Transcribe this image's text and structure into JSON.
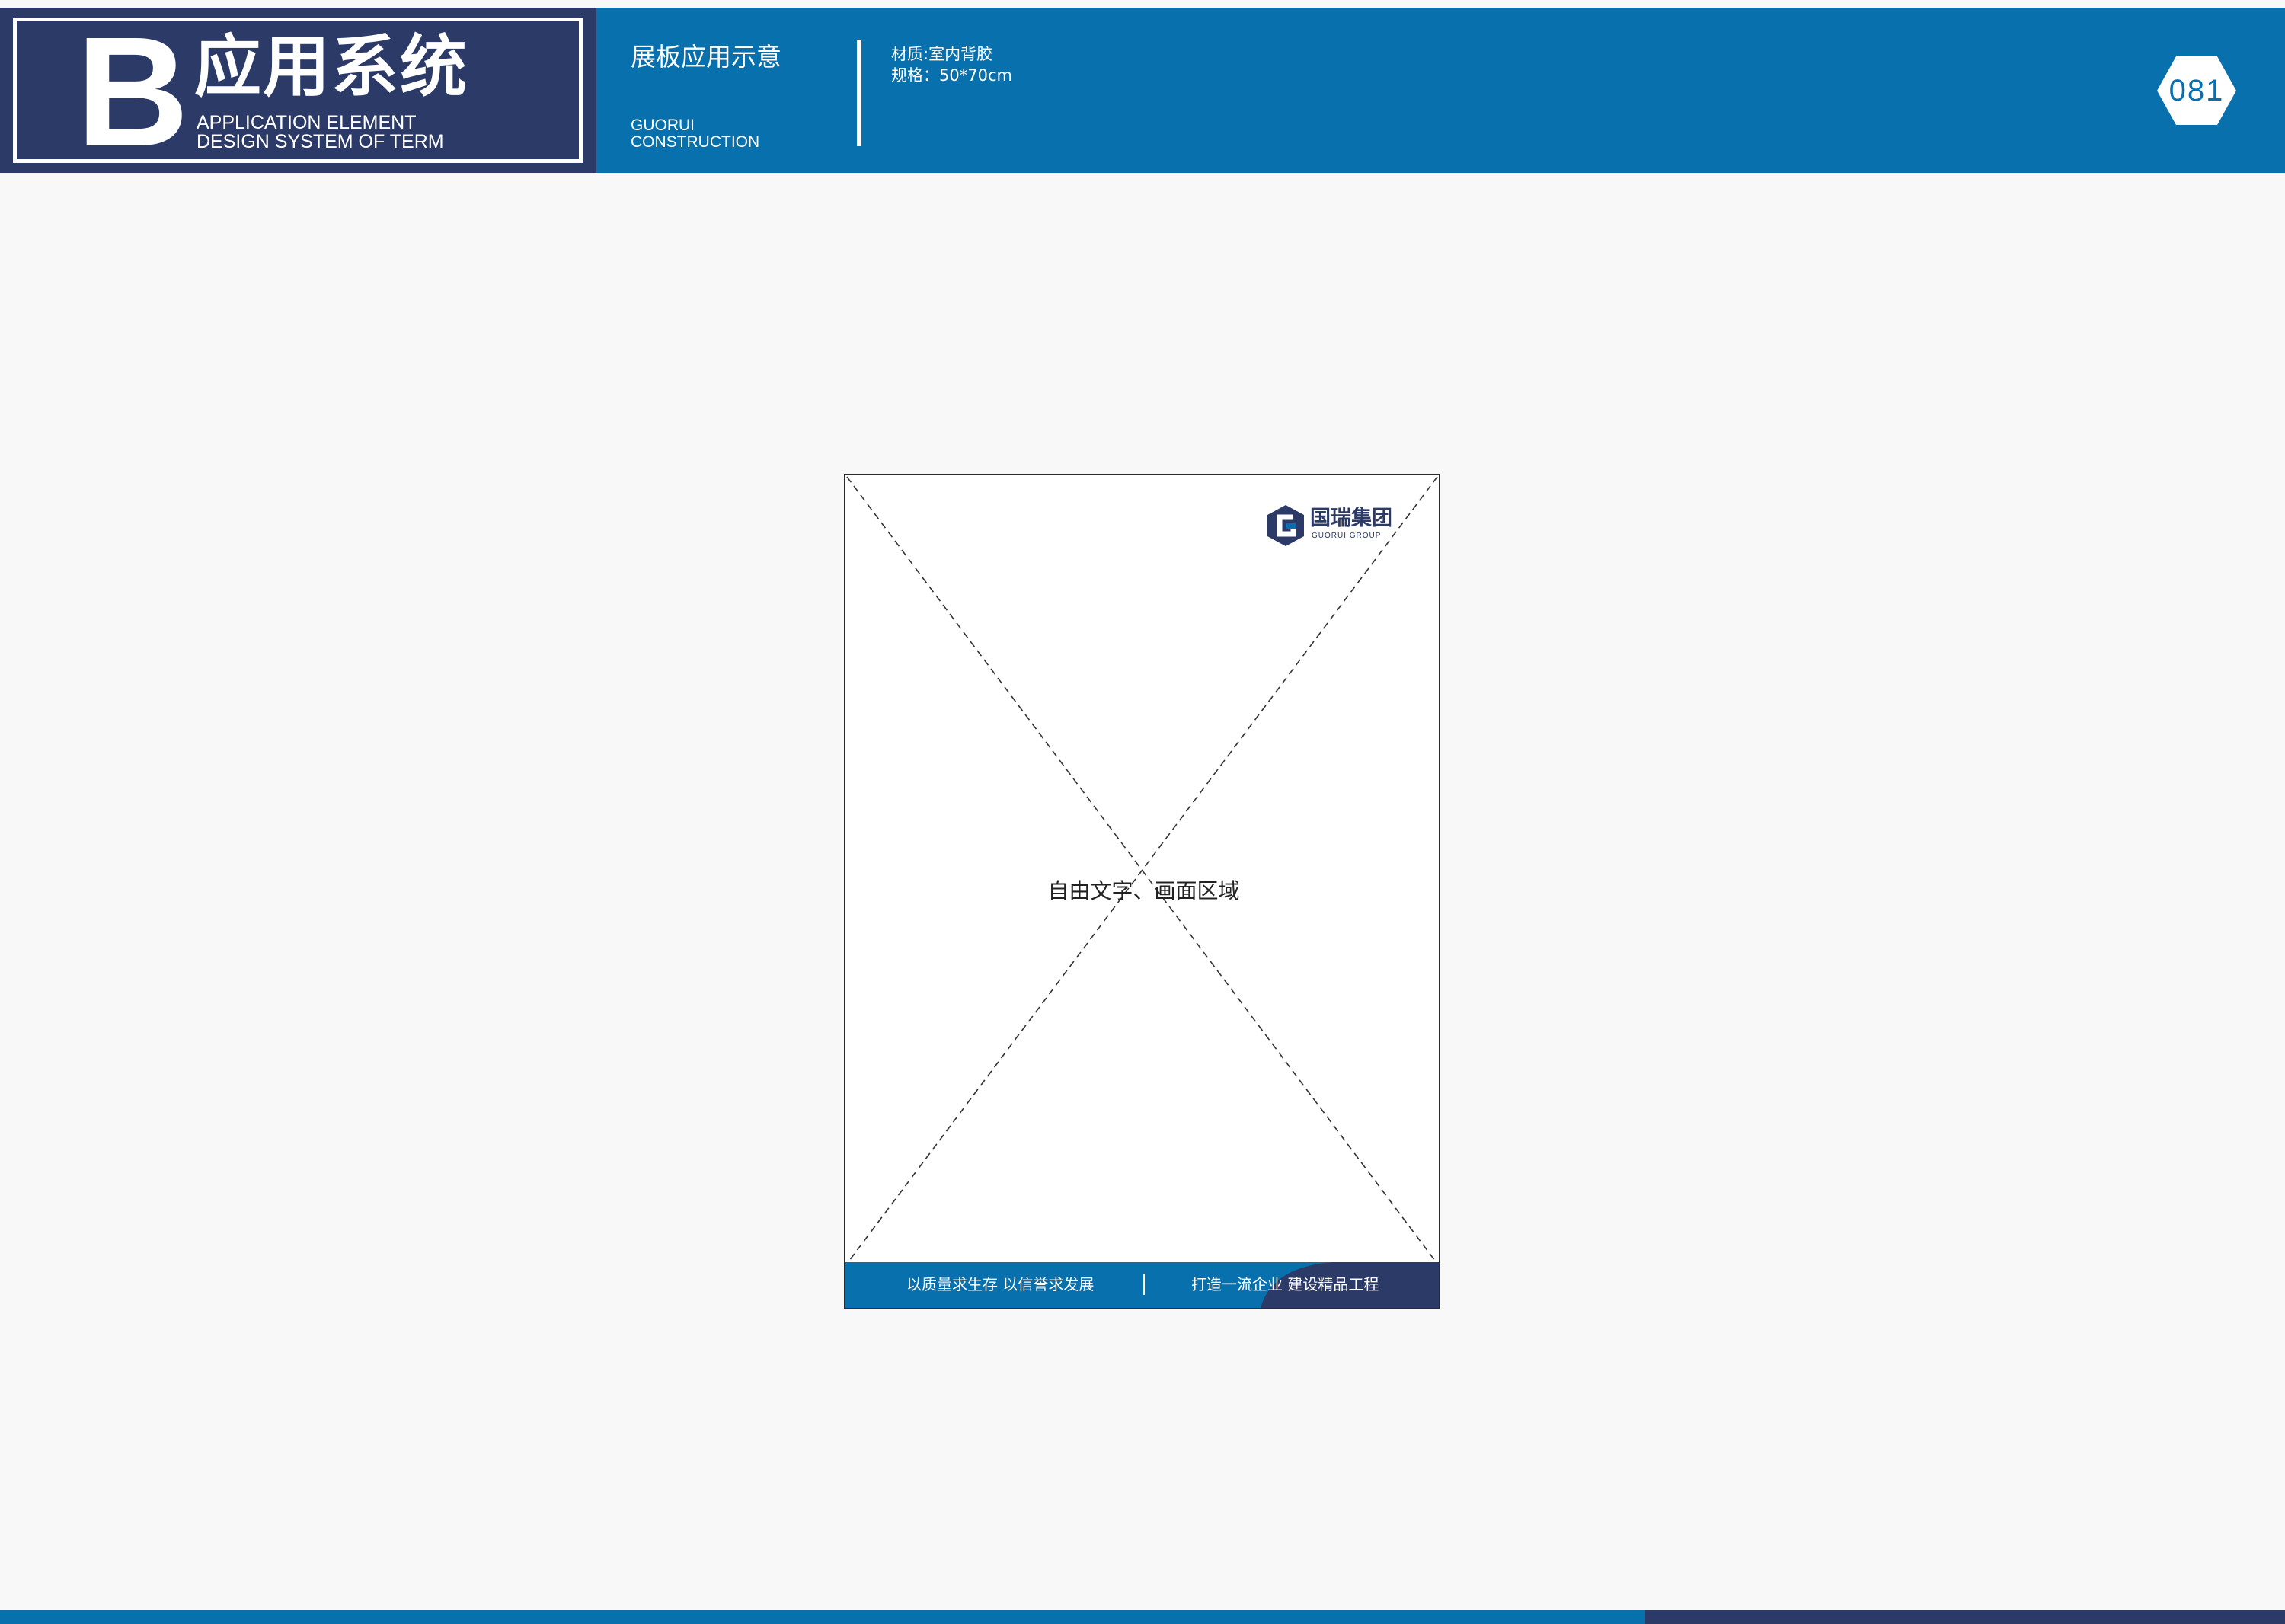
{
  "colors": {
    "primary_blue": "#0870ad",
    "navy": "#2b3a67",
    "page_background": "#f8f8f8",
    "white": "#ffffff"
  },
  "header": {
    "brand_letter": "B",
    "brand_title": "应用系统",
    "brand_subtitle_line1": "APPLICATION ELEMENT",
    "brand_subtitle_line2": "DESIGN SYSTEM OF TERM",
    "section_title": "展板应用示意",
    "company_en_line1": "GUORUI",
    "company_en_line2": "CONSTRUCTION",
    "material": "材质:室内背胶",
    "size": "规格：50*70cm",
    "page_number": "081"
  },
  "board": {
    "logo_mark_icon": "guorui-g-logo-icon",
    "logo_text_cn": "国瑞集团",
    "logo_text_en": "GUORUI GROUP",
    "placeholder_text": "自由文字、画面区域",
    "slogan_left": "以质量求生存  以信誉求发展",
    "slogan_right": "打造一流企业  建设精品工程"
  }
}
